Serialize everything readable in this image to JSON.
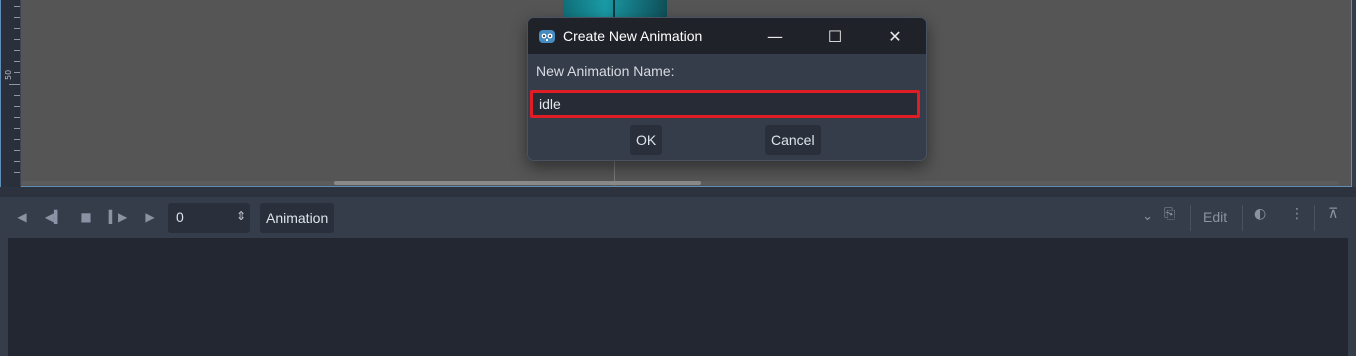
{
  "viewport": {
    "ruler_label": "50"
  },
  "toolbar": {
    "frame_value": "0",
    "animation_label": "Animation",
    "edit_label": "Edit"
  },
  "dialog": {
    "title": "Create New Animation",
    "name_label": "New Animation Name:",
    "name_value": "idle",
    "ok_label": "OK",
    "cancel_label": "Cancel"
  },
  "colors": {
    "highlight": "#e01c24",
    "titlebar": "#1f2329",
    "panel": "#363d4a"
  },
  "icons": [
    "godot-icon",
    "minimize-icon",
    "maximize-icon",
    "close-icon",
    "play-backwards-icon",
    "step-back-icon",
    "stop-icon",
    "step-forward-icon",
    "play-icon",
    "spin-icon",
    "chevron-down-icon",
    "autoplay-icon",
    "onion-skin-icon",
    "more-icon",
    "pin-icon"
  ]
}
